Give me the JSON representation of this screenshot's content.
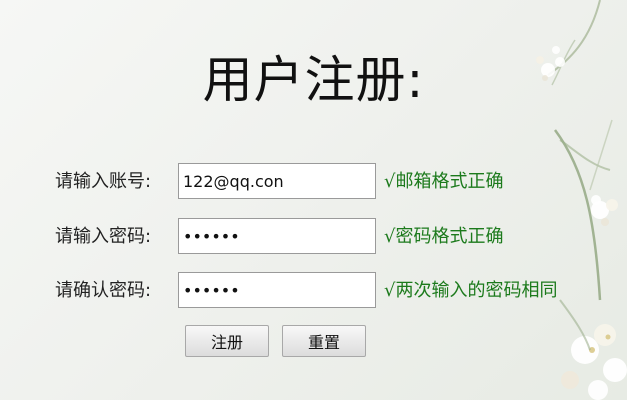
{
  "title": "用户注册:",
  "form": {
    "account": {
      "label": "请输入账号:",
      "value": "122@qq.con",
      "message": "√邮箱格式正确"
    },
    "password": {
      "label": "请输入密码:",
      "value": "123456",
      "message": "√密码格式正确"
    },
    "confirm": {
      "label": "请确认密码:",
      "value": "123456",
      "message": "√两次输入的密码相同"
    }
  },
  "buttons": {
    "register": "注册",
    "reset": "重置"
  },
  "colors": {
    "success": "#1c7a1c",
    "text": "#111111",
    "background": "#f2f4f0"
  }
}
